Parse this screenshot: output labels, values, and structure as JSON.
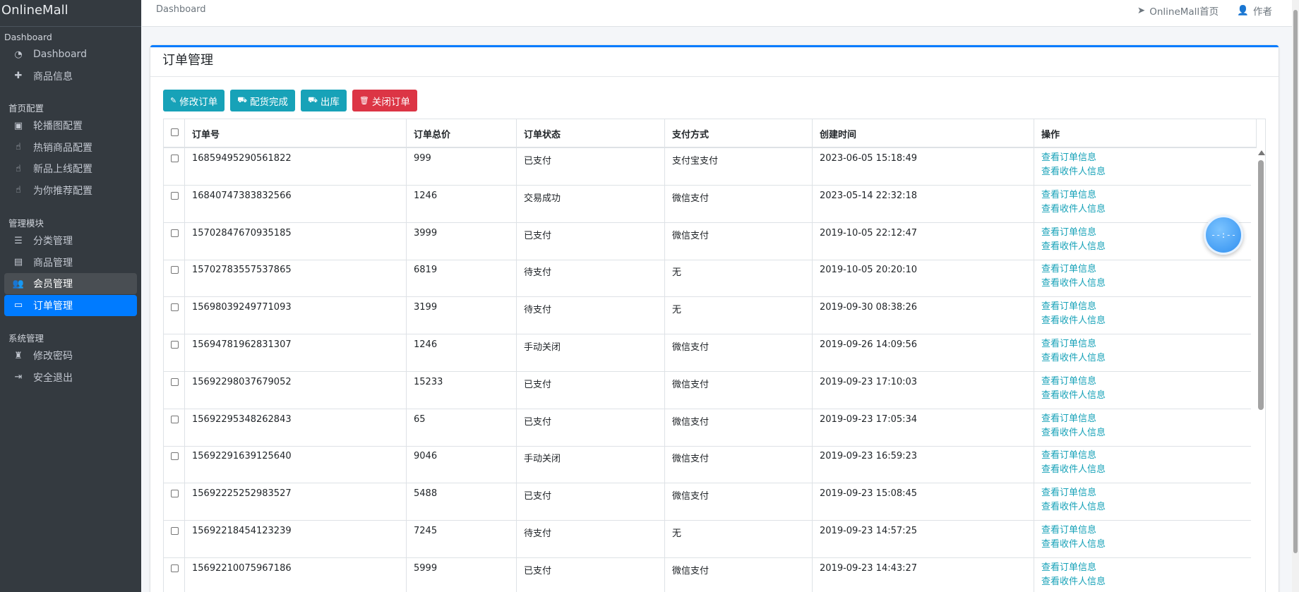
{
  "brand": "OnlineMall",
  "sidebar": {
    "sections": [
      {
        "header": "Dashboard",
        "items": [
          {
            "label": "Dashboard",
            "icon": "dashboard-icon"
          },
          {
            "label": "商品信息",
            "icon": "plus-icon"
          }
        ]
      },
      {
        "header": "首页配置",
        "items": [
          {
            "label": "轮播图配置",
            "icon": "image-icon"
          },
          {
            "label": "热销商品配置",
            "icon": "hand-pointer-icon"
          },
          {
            "label": "新品上线配置",
            "icon": "hand-pointer-icon"
          },
          {
            "label": "为你推荐配置",
            "icon": "hand-pointer-icon"
          }
        ]
      },
      {
        "header": "管理模块",
        "items": [
          {
            "label": "分类管理",
            "icon": "list-alt-icon"
          },
          {
            "label": "商品管理",
            "icon": "archive-icon"
          },
          {
            "label": "会员管理",
            "icon": "users-icon",
            "state": "hovered"
          },
          {
            "label": "订单管理",
            "icon": "money-bill-icon",
            "state": "active"
          }
        ]
      },
      {
        "header": "系统管理",
        "items": [
          {
            "label": "修改密码",
            "icon": "user-secret-icon"
          },
          {
            "label": "安全退出",
            "icon": "sign-out-icon"
          }
        ]
      }
    ]
  },
  "topbar": {
    "breadcrumb": "Dashboard",
    "home_link": "OnlineMall首页",
    "author_link": "作者"
  },
  "card": {
    "title": "订单管理"
  },
  "toolbar": {
    "edit_label": "修改订单",
    "packed_label": "配货完成",
    "ship_label": "出库",
    "close_label": "关闭订单"
  },
  "table": {
    "headers": [
      "订单号",
      "订单总价",
      "订单状态",
      "支付方式",
      "创建时间",
      "操作"
    ],
    "action_view_order": "查看订单信息",
    "action_view_recipient": "查看收件人信息",
    "rows": [
      {
        "order_no": "16859495290561822",
        "total": "999",
        "status": "已支付",
        "pay": "支付宝支付",
        "created": "2023-06-05 15:18:49"
      },
      {
        "order_no": "16840747383832566",
        "total": "1246",
        "status": "交易成功",
        "pay": "微信支付",
        "created": "2023-05-14 22:32:18"
      },
      {
        "order_no": "15702847670935185",
        "total": "3999",
        "status": "已支付",
        "pay": "微信支付",
        "created": "2019-10-05 22:12:47"
      },
      {
        "order_no": "15702783557537865",
        "total": "6819",
        "status": "待支付",
        "pay": "无",
        "created": "2019-10-05 20:20:10"
      },
      {
        "order_no": "15698039249771093",
        "total": "3199",
        "status": "待支付",
        "pay": "无",
        "created": "2019-09-30 08:38:26"
      },
      {
        "order_no": "15694781962831307",
        "total": "1246",
        "status": "手动关闭",
        "pay": "微信支付",
        "created": "2019-09-26 14:09:56"
      },
      {
        "order_no": "15692298037679052",
        "total": "15233",
        "status": "已支付",
        "pay": "微信支付",
        "created": "2019-09-23 17:10:03"
      },
      {
        "order_no": "15692295348262843",
        "total": "65",
        "status": "已支付",
        "pay": "微信支付",
        "created": "2019-09-23 17:05:34"
      },
      {
        "order_no": "15692291639125640",
        "total": "9046",
        "status": "手动关闭",
        "pay": "微信支付",
        "created": "2019-09-23 16:59:23"
      },
      {
        "order_no": "15692225252983527",
        "total": "5488",
        "status": "已支付",
        "pay": "微信支付",
        "created": "2019-09-23 15:08:45"
      },
      {
        "order_no": "15692218454123239",
        "total": "7245",
        "status": "待支付",
        "pay": "无",
        "created": "2019-09-23 14:57:25"
      },
      {
        "order_no": "15692210075967186",
        "total": "5999",
        "status": "已支付",
        "pay": "微信支付",
        "created": "2019-09-23 14:43:27"
      }
    ]
  },
  "floating_widget": {
    "text": "--:--"
  },
  "colors": {
    "sidebar_bg": "#343a40",
    "active": "#007bff",
    "info": "#17a2b8",
    "danger": "#dc3545"
  }
}
